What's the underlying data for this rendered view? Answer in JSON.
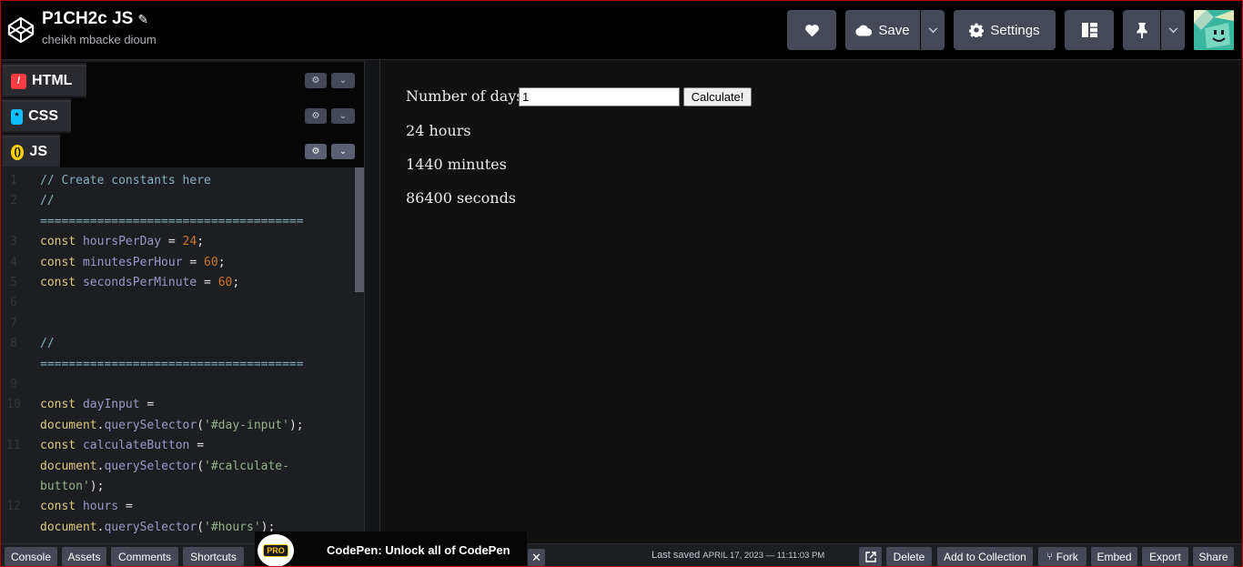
{
  "header": {
    "pen_title": "P1CH2c JS",
    "author": "cheikh mbacke dioum",
    "save_label": "Save",
    "settings_label": "Settings"
  },
  "editors": {
    "html_label": "HTML",
    "css_label": "CSS",
    "js_label": "JS"
  },
  "code_lines": [
    {
      "num": "1",
      "tokens": [
        {
          "t": "// Create constants here",
          "c": "c-com"
        }
      ]
    },
    {
      "num": "2",
      "tokens": [
        {
          "t": "//",
          "c": "c-com"
        }
      ]
    },
    {
      "num": "",
      "tokens": [
        {
          "t": "=====================================",
          "c": "c-com"
        }
      ]
    },
    {
      "num": "3",
      "tokens": [
        {
          "t": "const ",
          "c": "c-kw"
        },
        {
          "t": "hoursPerDay",
          "c": "c-var"
        },
        {
          "t": " = ",
          "c": "c-pl"
        },
        {
          "t": "24",
          "c": "c-num"
        },
        {
          "t": ";",
          "c": "c-pl"
        }
      ]
    },
    {
      "num": "4",
      "tokens": [
        {
          "t": "const ",
          "c": "c-kw"
        },
        {
          "t": "minutesPerHour",
          "c": "c-var"
        },
        {
          "t": " = ",
          "c": "c-pl"
        },
        {
          "t": "60",
          "c": "c-num"
        },
        {
          "t": ";",
          "c": "c-pl"
        }
      ]
    },
    {
      "num": "5",
      "tokens": [
        {
          "t": "const ",
          "c": "c-kw"
        },
        {
          "t": "secondsPerMinute",
          "c": "c-var"
        },
        {
          "t": " = ",
          "c": "c-pl"
        },
        {
          "t": "60",
          "c": "c-num"
        },
        {
          "t": ";",
          "c": "c-pl"
        }
      ]
    },
    {
      "num": "6",
      "tokens": []
    },
    {
      "num": "7",
      "tokens": []
    },
    {
      "num": "8",
      "tokens": [
        {
          "t": "//",
          "c": "c-com"
        }
      ]
    },
    {
      "num": "",
      "tokens": [
        {
          "t": "=====================================",
          "c": "c-com"
        }
      ]
    },
    {
      "num": "9",
      "tokens": []
    },
    {
      "num": "10",
      "tokens": [
        {
          "t": "const ",
          "c": "c-kw"
        },
        {
          "t": "dayInput",
          "c": "c-var"
        },
        {
          "t": " =",
          "c": "c-pl"
        }
      ]
    },
    {
      "num": "",
      "tokens": [
        {
          "t": "document",
          "c": "c-kw"
        },
        {
          "t": ".",
          "c": "c-pl"
        },
        {
          "t": "querySelector",
          "c": "c-var"
        },
        {
          "t": "(",
          "c": "c-pl"
        },
        {
          "t": "'#day-input'",
          "c": "c-str"
        },
        {
          "t": ");",
          "c": "c-pl"
        }
      ]
    },
    {
      "num": "11",
      "tokens": [
        {
          "t": "const ",
          "c": "c-kw"
        },
        {
          "t": "calculateButton",
          "c": "c-var"
        },
        {
          "t": " =",
          "c": "c-pl"
        }
      ]
    },
    {
      "num": "",
      "tokens": [
        {
          "t": "document",
          "c": "c-kw"
        },
        {
          "t": ".",
          "c": "c-pl"
        },
        {
          "t": "querySelector",
          "c": "c-var"
        },
        {
          "t": "(",
          "c": "c-pl"
        },
        {
          "t": "'#calculate-",
          "c": "c-str"
        }
      ]
    },
    {
      "num": "",
      "tokens": [
        {
          "t": "button'",
          "c": "c-str"
        },
        {
          "t": ");",
          "c": "c-pl"
        }
      ]
    },
    {
      "num": "12",
      "tokens": [
        {
          "t": "const ",
          "c": "c-kw"
        },
        {
          "t": "hours",
          "c": "c-var"
        },
        {
          "t": " =",
          "c": "c-pl"
        }
      ]
    },
    {
      "num": "",
      "tokens": [
        {
          "t": "document",
          "c": "c-kw"
        },
        {
          "t": ".",
          "c": "c-pl"
        },
        {
          "t": "querySelector",
          "c": "c-var"
        },
        {
          "t": "(",
          "c": "c-pl"
        },
        {
          "t": "'#hours'",
          "c": "c-str"
        },
        {
          "t": ");",
          "c": "c-pl"
        }
      ]
    }
  ],
  "preview": {
    "days_label": "Number of days",
    "day_input_value": "1",
    "calculate_label": "Calculate!",
    "hours_text": "24 hours",
    "minutes_text": "1440 minutes",
    "seconds_text": "86400 seconds"
  },
  "footer": {
    "console": "Console",
    "assets": "Assets",
    "comments": "Comments",
    "shortcuts": "Shortcuts",
    "pro_badge": "PRO",
    "pro_text": "CodePen: Unlock all of CodePen",
    "close_symbol": "✕",
    "last_saved_label": "Last saved",
    "last_saved_time": "APRIL 17, 2023 — 11:11:03 PM",
    "delete": "Delete",
    "add_to_collection": "Add to Collection",
    "fork": "Fork",
    "embed": "Embed",
    "export": "Export",
    "share": "Share"
  },
  "colors": {
    "button_bg": "#444857",
    "editor_bg": "#1d1e22",
    "html_icon": "#ff3c41",
    "css_icon": "#0ebeff",
    "js_icon": "#fcd000"
  }
}
